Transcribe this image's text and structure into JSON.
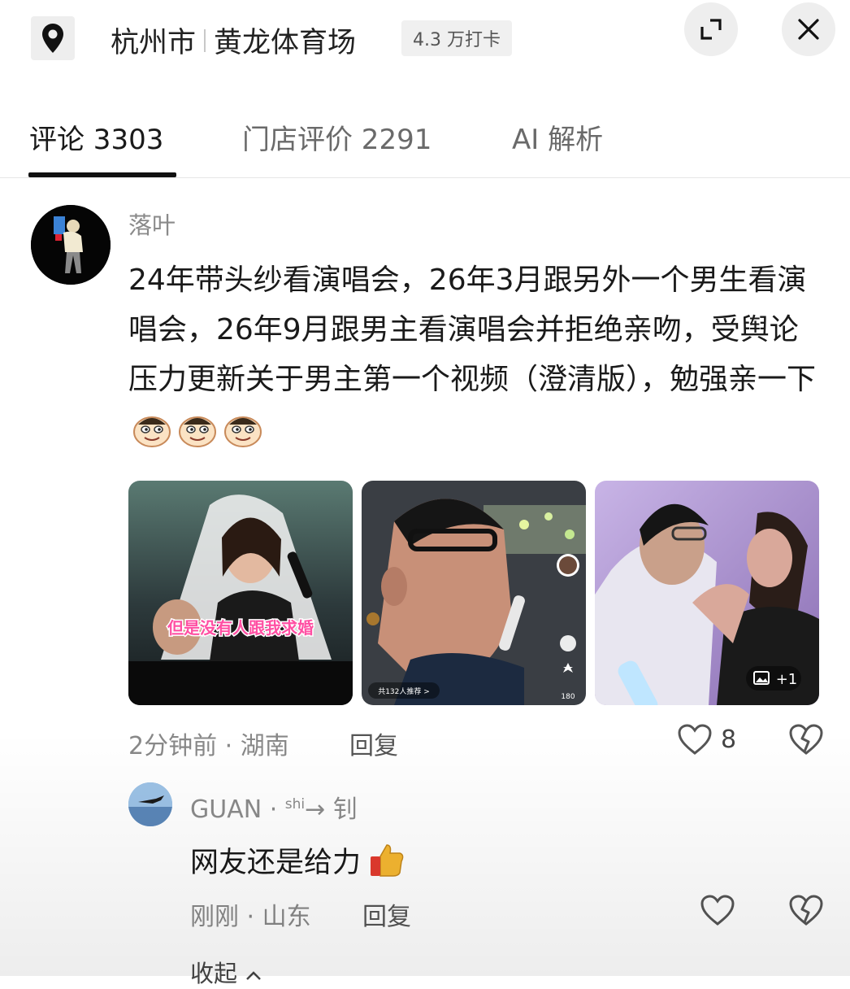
{
  "header": {
    "city": "杭州市",
    "place": "黄龙体育场",
    "checkins": "4.3 万打卡"
  },
  "tabs": [
    {
      "label": "评论 3303",
      "active": true
    },
    {
      "label": "门店评价 2291",
      "active": false
    },
    {
      "label": "AI 解析",
      "active": false
    }
  ],
  "comment": {
    "user": "落叶",
    "text": "24年带头纱看演唱会，26年3月跟另外一个男生看演唱会，26年9月跟男主看演唱会并拒绝亲吻，受舆论压力更新关于男主第一个视频（澄清版），勉强亲一下",
    "images": [
      {
        "caption": "但是没有人跟我求婚"
      },
      {
        "caption": "共132人推荐 >",
        "side_count": "180"
      },
      {
        "more": "+1"
      }
    ],
    "time_location": "2分钟前 · 湖南",
    "reply_label": "回复",
    "likes": "8"
  },
  "sub_comment": {
    "user": "GUAN",
    "user_suffix_sup": "shi",
    "user_suffix": "→ 钊",
    "text": "网友还是给力",
    "time_location": "刚刚 · 山东",
    "reply_label": "回复"
  },
  "collapse_label": "收起",
  "colors": {
    "accent": "#111111",
    "muted": "#888888",
    "caption": "#ff4fa3"
  }
}
